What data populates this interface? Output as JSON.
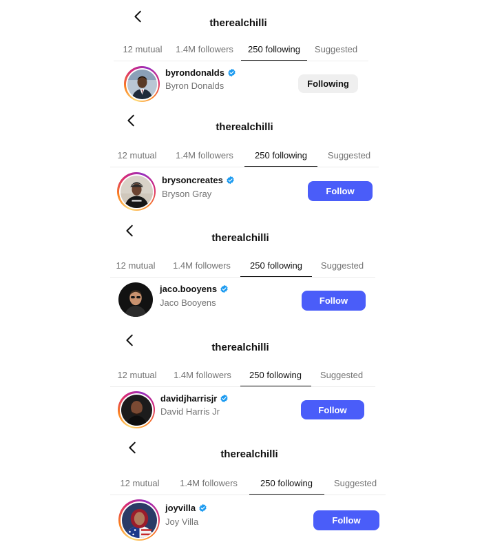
{
  "colors": {
    "follow_button": "#4a5df9",
    "following_button": "#efefef",
    "muted_text": "#737373",
    "verified_badge": "#1d9bf0"
  },
  "panels": [
    {
      "title": "therealchilli",
      "tabs": [
        "12 mutual",
        "1.4M followers",
        "250 following",
        "Suggested"
      ],
      "active_tab": "250 following",
      "user": {
        "handle": "byrondonalds",
        "name": "Byron Donalds",
        "verified": true,
        "story_ring": true
      },
      "button": "Following"
    },
    {
      "title": "therealchilli",
      "tabs": [
        "12 mutual",
        "1.4M followers",
        "250 following",
        "Suggested"
      ],
      "active_tab": "250 following",
      "user": {
        "handle": "brysoncreates",
        "name": "Bryson Gray",
        "verified": true,
        "story_ring": true
      },
      "button": "Follow"
    },
    {
      "title": "therealchilli",
      "tabs": [
        "12 mutual",
        "1.4M followers",
        "250 following",
        "Suggested"
      ],
      "active_tab": "250 following",
      "user": {
        "handle": "jaco.booyens",
        "name": "Jaco Booyens",
        "verified": true,
        "story_ring": false
      },
      "button": "Follow"
    },
    {
      "title": "therealchilli",
      "tabs": [
        "12 mutual",
        "1.4M followers",
        "250 following",
        "Suggested"
      ],
      "active_tab": "250 following",
      "user": {
        "handle": "davidjharrisjr",
        "name": "David Harris Jr",
        "verified": true,
        "story_ring": true
      },
      "button": "Follow"
    },
    {
      "title": "therealchilli",
      "tabs": [
        "12 mutual",
        "1.4M followers",
        "250 following",
        "Suggested"
      ],
      "active_tab": "250 following",
      "user": {
        "handle": "joyvilla",
        "name": "Joy Villa",
        "verified": true,
        "story_ring": true
      },
      "button": "Follow"
    }
  ]
}
